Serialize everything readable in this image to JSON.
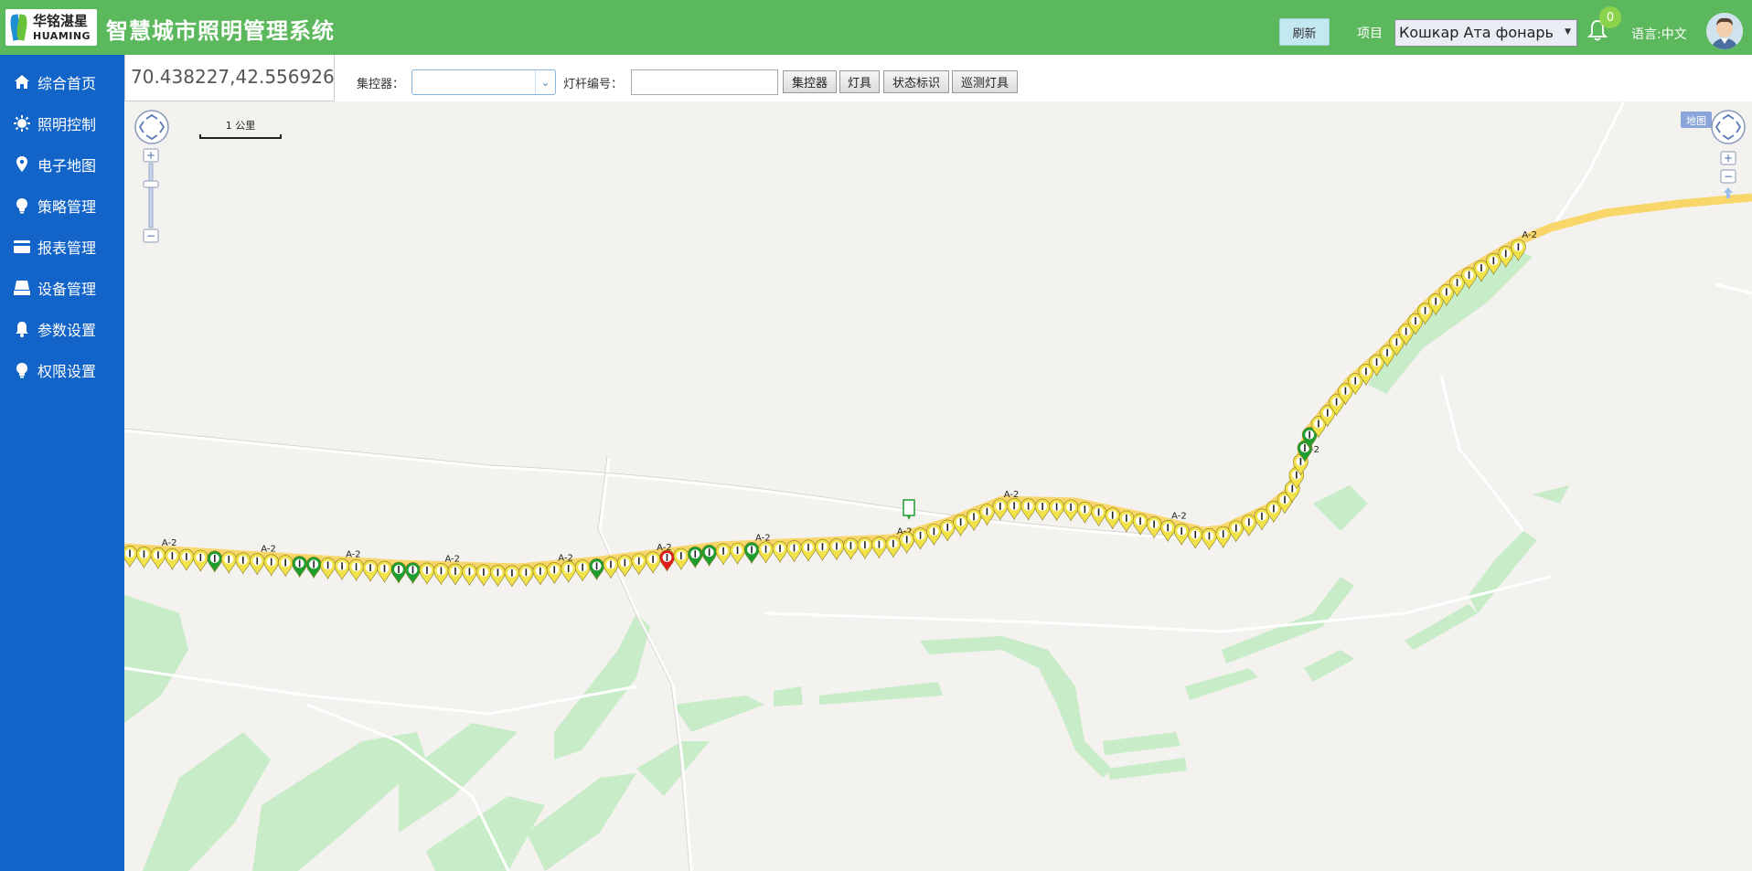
{
  "header": {
    "logo_cn": "华铭湛星",
    "logo_en": "HUAMING",
    "title": "智慧城市照明管理系统",
    "refresh_label": "刷新",
    "project_label": "项目",
    "project_value": "Кошкар Ата фонарь",
    "notification_count": "0",
    "language_label": "语言:中文"
  },
  "sidebar": {
    "items": [
      {
        "label": "综合首页",
        "icon": "home-icon"
      },
      {
        "label": "照明控制",
        "icon": "sun-icon"
      },
      {
        "label": "电子地图",
        "icon": "map-pin-icon"
      },
      {
        "label": "策略管理",
        "icon": "bulb-icon"
      },
      {
        "label": "报表管理",
        "icon": "card-icon"
      },
      {
        "label": "设备管理",
        "icon": "device-icon"
      },
      {
        "label": "参数设置",
        "icon": "bell-icon"
      },
      {
        "label": "权限设置",
        "icon": "bulb-icon"
      }
    ]
  },
  "toolbar": {
    "coordinates": "70.438227,42.556926",
    "controller_label": "集控器：",
    "controller_value": "",
    "pole_label": "灯杆编号：",
    "pole_value": "",
    "buttons": [
      "集控器",
      "灯具",
      "状态标识",
      "巡测灯具"
    ]
  },
  "map": {
    "scale_label": "1 公里",
    "map_type_label": "地图",
    "zoom_in": "+",
    "zoom_out": "−",
    "marker_label": "A-2",
    "colors": {
      "road": "#f9d66a",
      "park": "#c8ebc8",
      "marker_yellow": "#f2e34a",
      "marker_green": "#1e9e2e",
      "marker_red": "#e21b1b"
    }
  }
}
